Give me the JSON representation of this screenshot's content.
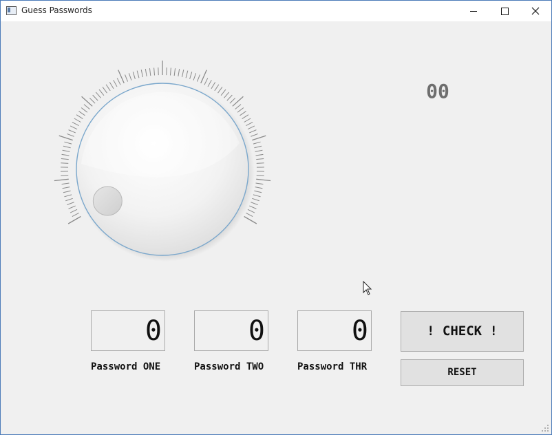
{
  "window": {
    "title": "Guess Passwords"
  },
  "dial": {
    "tick_count": 100,
    "value_fraction": 0.0,
    "colors": {
      "ring": "#7aa7cc",
      "tick": "#8a8a8a"
    }
  },
  "counter": {
    "value": "00"
  },
  "passwords": [
    {
      "digit": "0",
      "label": "Password ONE"
    },
    {
      "digit": "0",
      "label": "Password TWO"
    },
    {
      "digit": "0",
      "label": "Password THR"
    }
  ],
  "buttons": {
    "check_label": "! CHECK !",
    "reset_label": "RESET"
  }
}
